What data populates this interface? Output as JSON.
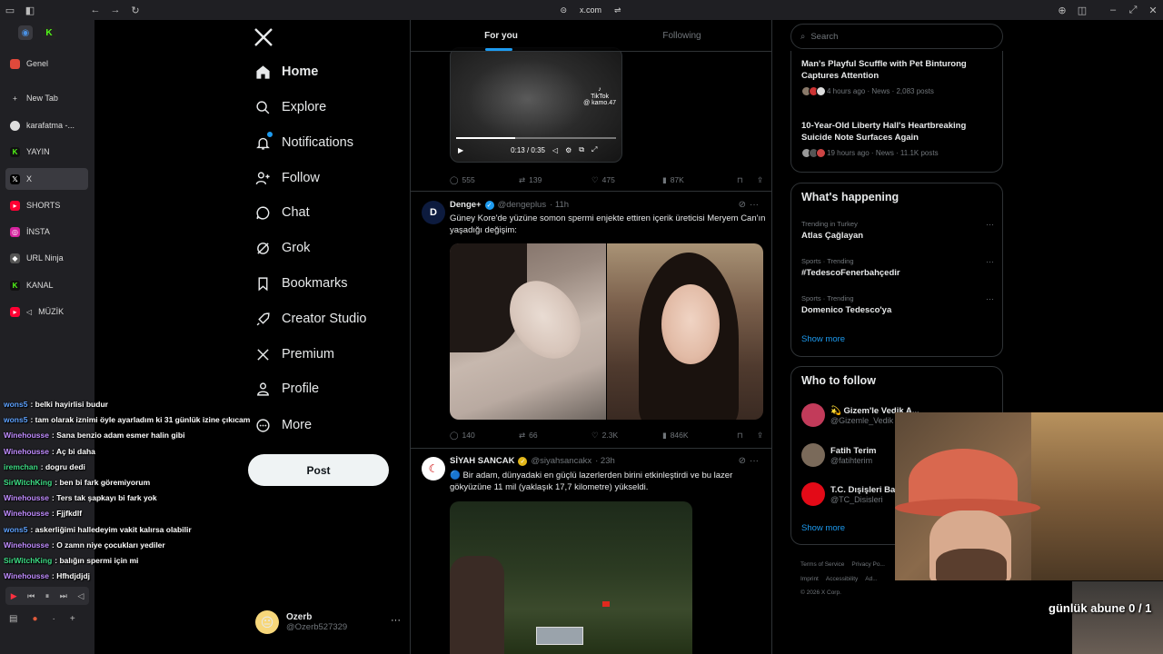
{
  "browser": {
    "url": "x.com",
    "colors": {
      "chrome_bg": "#1f1f23",
      "sidebar_bg": "#202024"
    },
    "tabs": [
      {
        "label": "Genel",
        "favicon": "kick-icon"
      },
      {
        "label": "New Tab",
        "favicon": "plus-icon"
      },
      {
        "label": "karafatma -...",
        "favicon": "globe-icon"
      },
      {
        "label": "YAYIN",
        "favicon": "kick-icon"
      },
      {
        "label": "X",
        "favicon": "x-icon",
        "active": true
      },
      {
        "label": "SHORTS",
        "favicon": "youtube-icon"
      },
      {
        "label": "İNSTA",
        "favicon": "instagram-icon"
      },
      {
        "label": "URL Ninja",
        "favicon": "ninja-icon"
      },
      {
        "label": "KANAL",
        "favicon": "kick-icon"
      },
      {
        "label": "MÜZİK",
        "favicon": "youtube-icon"
      }
    ]
  },
  "chat": [
    {
      "user": "wons5",
      "msg": ": belki hayirlisi budur",
      "color": "#5ea2ff"
    },
    {
      "user": "wons5",
      "msg": ": tam olarak iznimi öyle ayarladım ki 31 günlük izine çıkıcam",
      "color": "#5ea2ff"
    },
    {
      "user": "Winehousse",
      "msg": ": Sana benzio adam esmer halin gibi",
      "color": "#c08cff"
    },
    {
      "user": "Winehousse",
      "msg": ": Aç bi daha",
      "color": "#c08cff"
    },
    {
      "user": "iremchan",
      "msg": ": dogru dedi",
      "color": "#3ddc84"
    },
    {
      "user": "SirWitchKing",
      "msg": ": ben bi fark göremiyorum",
      "color": "#3ddc84"
    },
    {
      "user": "Winehousse",
      "msg": ": Ters tak şapkayı bi fark yok",
      "color": "#c08cff"
    },
    {
      "user": "Winehousse",
      "msg": ": Fjjfkdlf",
      "color": "#c08cff"
    },
    {
      "user": "wons5",
      "msg": ": askerliğimi halledeyim vakit kalırsa olabilir",
      "color": "#5ea2ff"
    },
    {
      "user": "Winehousse",
      "msg": ": O zamn niye çocukları yediler",
      "color": "#c08cff"
    },
    {
      "user": "SirWitchKing",
      "msg": ": balığın spermi için mi",
      "color": "#3ddc84"
    },
    {
      "user": "Winehousse",
      "msg": ": Hfhdjdjdj",
      "color": "#c08cff"
    }
  ],
  "nav": {
    "items": [
      {
        "label": "Home",
        "icon": "home-icon"
      },
      {
        "label": "Explore",
        "icon": "search-icon"
      },
      {
        "label": "Notifications",
        "icon": "bell-icon"
      },
      {
        "label": "Follow",
        "icon": "add-person-icon"
      },
      {
        "label": "Chat",
        "icon": "chat-bubble-icon"
      },
      {
        "label": "Grok",
        "icon": "grok-icon"
      },
      {
        "label": "Bookmarks",
        "icon": "bookmark-icon"
      },
      {
        "label": "Creator Studio",
        "icon": "rocket-icon"
      },
      {
        "label": "Premium",
        "icon": "x-icon"
      },
      {
        "label": "Profile",
        "icon": "person-icon"
      },
      {
        "label": "More",
        "icon": "more-circle-icon"
      }
    ],
    "post_label": "Post",
    "account": {
      "name": "Ozerb",
      "handle": "@Ozerb527329",
      "avatar": "😐"
    }
  },
  "timeline": {
    "tabs": [
      "For you",
      "Following"
    ],
    "video_post": {
      "video": {
        "watermark": "TikTok",
        "watermark_user": "@ kamo.47",
        "time": "0:13 / 0:35",
        "progress": 0.37
      },
      "replies": "555",
      "reposts": "139",
      "likes": "475",
      "views": "87K"
    },
    "post2": {
      "name": "Denge+",
      "handle": "@dengeplus",
      "time": "· 11h",
      "text": "Güney Kore'de yüzüne somon spermi enjekte ettiren içerik üreticisi Meryem Can'ın yaşadığı değişim:",
      "replies": "140",
      "reposts": "66",
      "likes": "2.3K",
      "views": "846K"
    },
    "post3": {
      "name": "SİYAH SANCAK",
      "handle": "@siyahsancakx",
      "time": "· 23h",
      "text": "🔵 Bir adam, dünyadaki en güçlü lazerlerden birini etkinleştirdi ve bu lazer gökyüzüne 11 mil (yaklaşık 17,7 kilometre) yükseldi."
    }
  },
  "right": {
    "search_placeholder": "Search",
    "news": [
      {
        "title": "Man's Playful Scuffle with Pet Binturong Captures Attention",
        "meta": "4 hours ago · News · 2,083 posts"
      },
      {
        "title": "10-Year-Old Liberty Hall's Heartbreaking Suicide Note Surfaces Again",
        "meta": "19 hours ago · News · 11.1K posts"
      }
    ],
    "happening_title": "What's happening",
    "trends": [
      {
        "context": "Trending in Turkey",
        "name": "Atlas Çağlayan"
      },
      {
        "context": "Sports · Trending",
        "name": "#TedescoFenerbahçedir"
      },
      {
        "context": "Sports · Trending",
        "name": "Domenico Tedesco'ya"
      }
    ],
    "show_more": "Show more",
    "who_title": "Who to follow",
    "follow": [
      {
        "name": "💫 Gizem'le Vedik A...",
        "handle": "@Gizemle_Vedik",
        "color": "#c23b5a"
      },
      {
        "name": "Fatih Terim",
        "handle": "@fatihterim",
        "color": "#7a6a5a"
      },
      {
        "name": "T.C. Dışişleri Ba...",
        "handle": "@TC_Disisleri",
        "color": "#e30a17"
      }
    ],
    "footer": [
      "Terms of Service",
      "Privacy Po...",
      "Imprint",
      "Accessibility",
      "Ad...",
      "© 2026 X Corp."
    ]
  },
  "stream": {
    "sub_goal": "günlük abune 0 / 1"
  }
}
